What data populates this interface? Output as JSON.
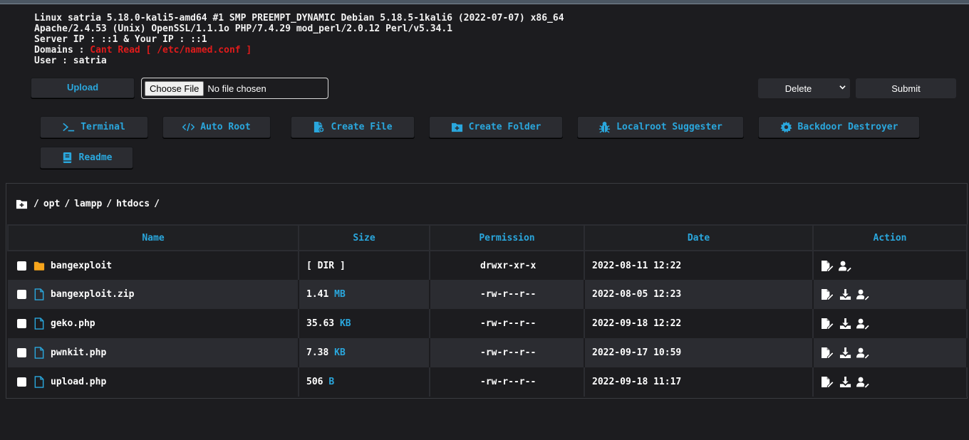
{
  "sysinfo": {
    "uname": "Linux satria 5.18.0-kali5-amd64 #1 SMP PREEMPT_DYNAMIC Debian 5.18.5-1kali6 (2022-07-07) x86_64",
    "software": "Apache/2.4.53 (Unix) OpenSSL/1.1.1o PHP/7.4.29 mod_perl/2.0.12 Perl/v5.34.1",
    "server_ip": "Server IP : ::1 & Your IP : ::1",
    "domains_label": "Domains : ",
    "domains_value": "Cant Read [ /etc/named.conf ]",
    "user": "User : satria"
  },
  "upload": {
    "button_label": "Upload",
    "choose_label": "Choose File",
    "no_file": "No file chosen"
  },
  "bulk": {
    "selected": "Delete",
    "submit_label": "Submit"
  },
  "tools": {
    "terminal": "Terminal",
    "auto_root": "Auto Root",
    "create_file": "Create File",
    "create_folder": "Create Folder",
    "localroot": "Localroot Suggester",
    "backdoor": "Backdoor Destroyer",
    "readme": "Readme"
  },
  "breadcrumb": {
    "sep": "/",
    "parts": [
      "opt",
      "lampp",
      "htdocs"
    ]
  },
  "table": {
    "headers": [
      "Name",
      "Size",
      "Permission",
      "Date",
      "Action"
    ],
    "rows": [
      {
        "name": "bangexploit",
        "type": "folder-icon",
        "size": "[ DIR ]",
        "unit": "",
        "perm": "drwxr-xr-x",
        "date": "2022-08-11 12:22"
      },
      {
        "name": "bangexploit.zip",
        "type": "file-icon",
        "size": "1.41",
        "unit": "MB",
        "perm": "-rw-r--r--",
        "date": "2022-08-05 12:23"
      },
      {
        "name": "geko.php",
        "type": "file-icon",
        "size": "35.63",
        "unit": "KB",
        "perm": "-rw-r--r--",
        "date": "2022-09-18 12:22"
      },
      {
        "name": "pwnkit.php",
        "type": "file-icon",
        "size": "7.38",
        "unit": "KB",
        "perm": "-rw-r--r--",
        "date": "2022-09-17 10:59"
      },
      {
        "name": "upload.php",
        "type": "file-icon",
        "size": "506",
        "unit": "B",
        "perm": "-rw-r--r--",
        "date": "2022-09-18 11:17"
      }
    ]
  },
  "colors": {
    "accent": "#2aa7dd",
    "danger": "#e01b1b",
    "folder": "#f7a51c",
    "background": "#1c1c1f",
    "button": "#2b2c31"
  }
}
